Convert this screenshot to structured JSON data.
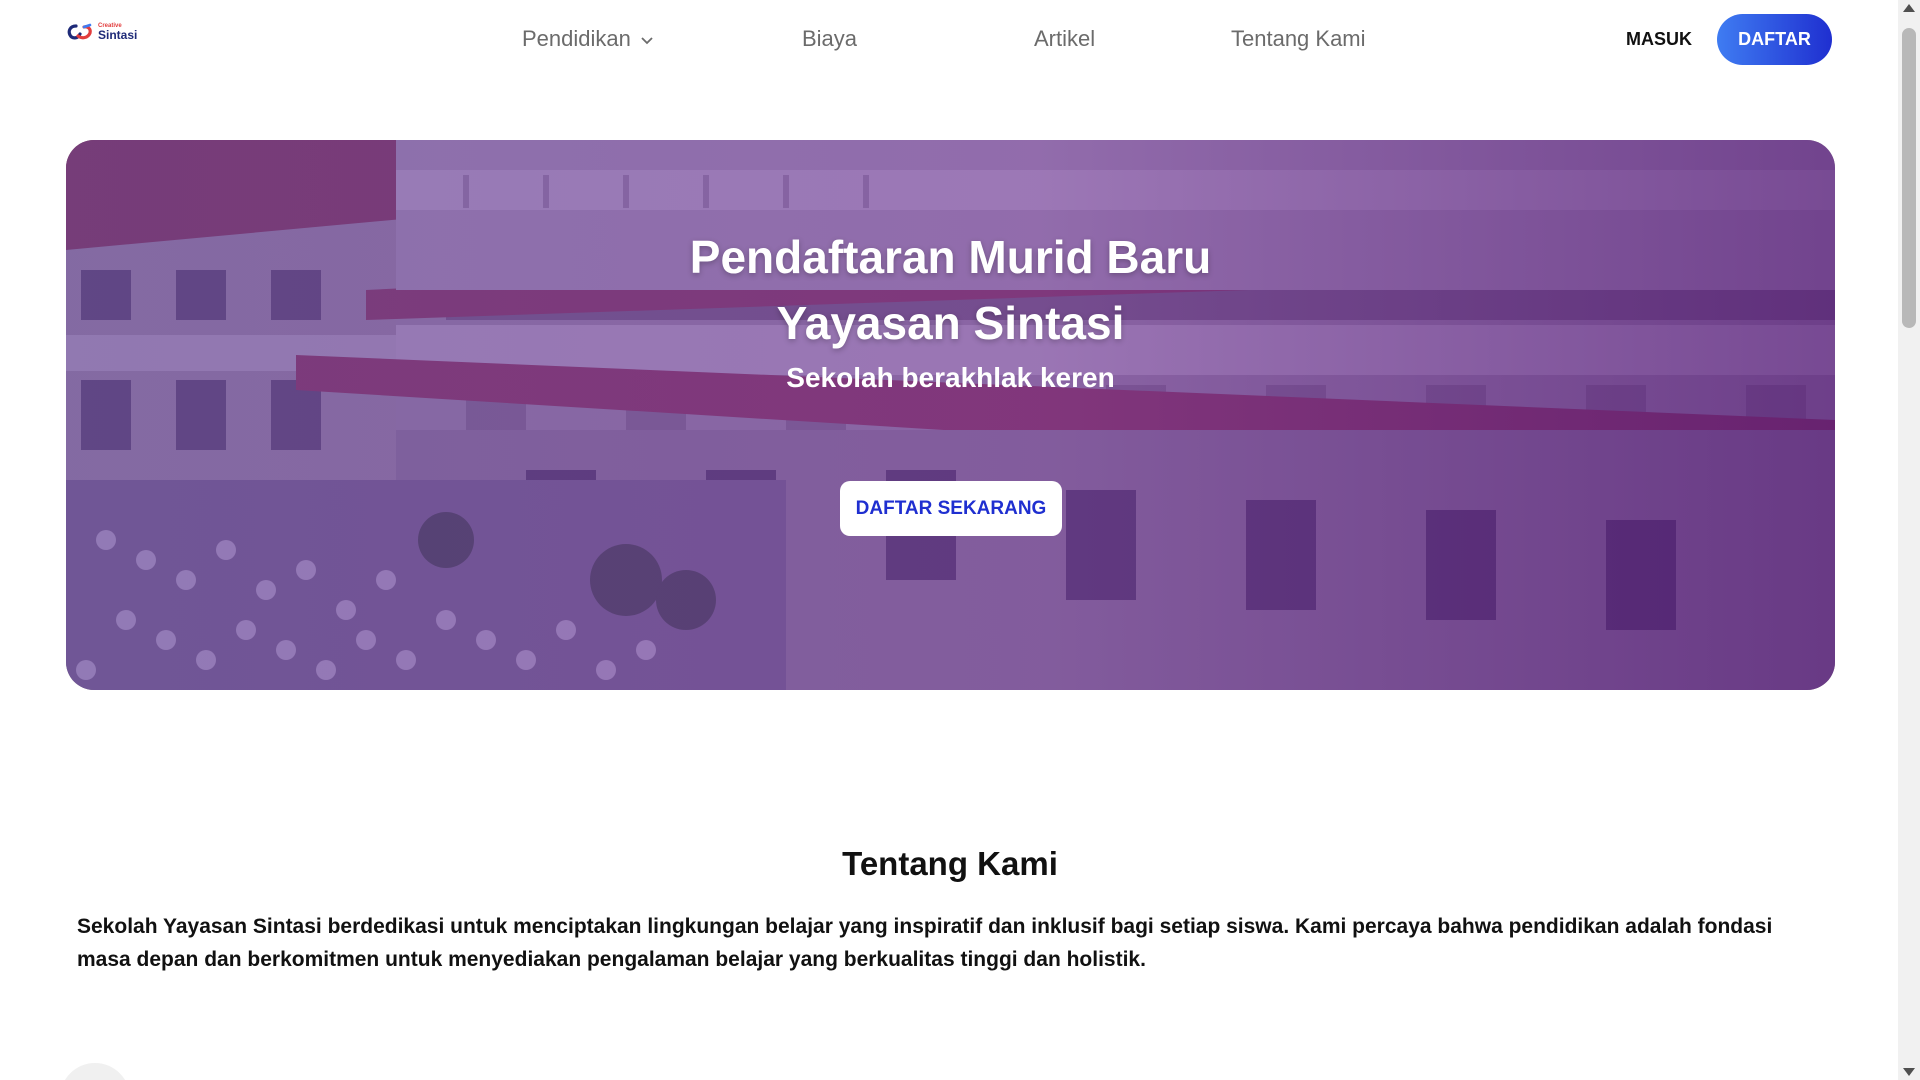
{
  "header": {
    "logo": {
      "small_text": "Creative",
      "name": "Sintasi",
      "icon": "sintasi-logo-icon"
    },
    "nav": [
      {
        "label": "Pendidikan",
        "has_dropdown": true
      },
      {
        "label": "Biaya"
      },
      {
        "label": "Artikel"
      },
      {
        "label": "Tentang Kami"
      }
    ],
    "login_label": "MASUK",
    "register_label": "DAFTAR"
  },
  "hero": {
    "title_line1": "Pendaftaran Murid Baru",
    "title_line2": "Yayasan Sintasi",
    "subtitle": "Sekolah berakhlak keren",
    "cta_label": "DAFTAR SEKARANG"
  },
  "about": {
    "title": "Tentang Kami",
    "text": "Sekolah Yayasan Sintasi berdedikasi untuk menciptakan lingkungan belajar yang inspiratif dan inklusif bagi setiap siswa. Kami percaya bahwa pendidikan adalah fondasi masa depan dan berkomitmen untuk menyediakan pengalaman belajar yang berkualitas tinggi dan holistik."
  },
  "colors": {
    "accent_start": "#3f7cf2",
    "accent_end": "#1f2fd0",
    "hero_overlay": "#5a2a96",
    "cta_text": "#1f2fd0"
  }
}
